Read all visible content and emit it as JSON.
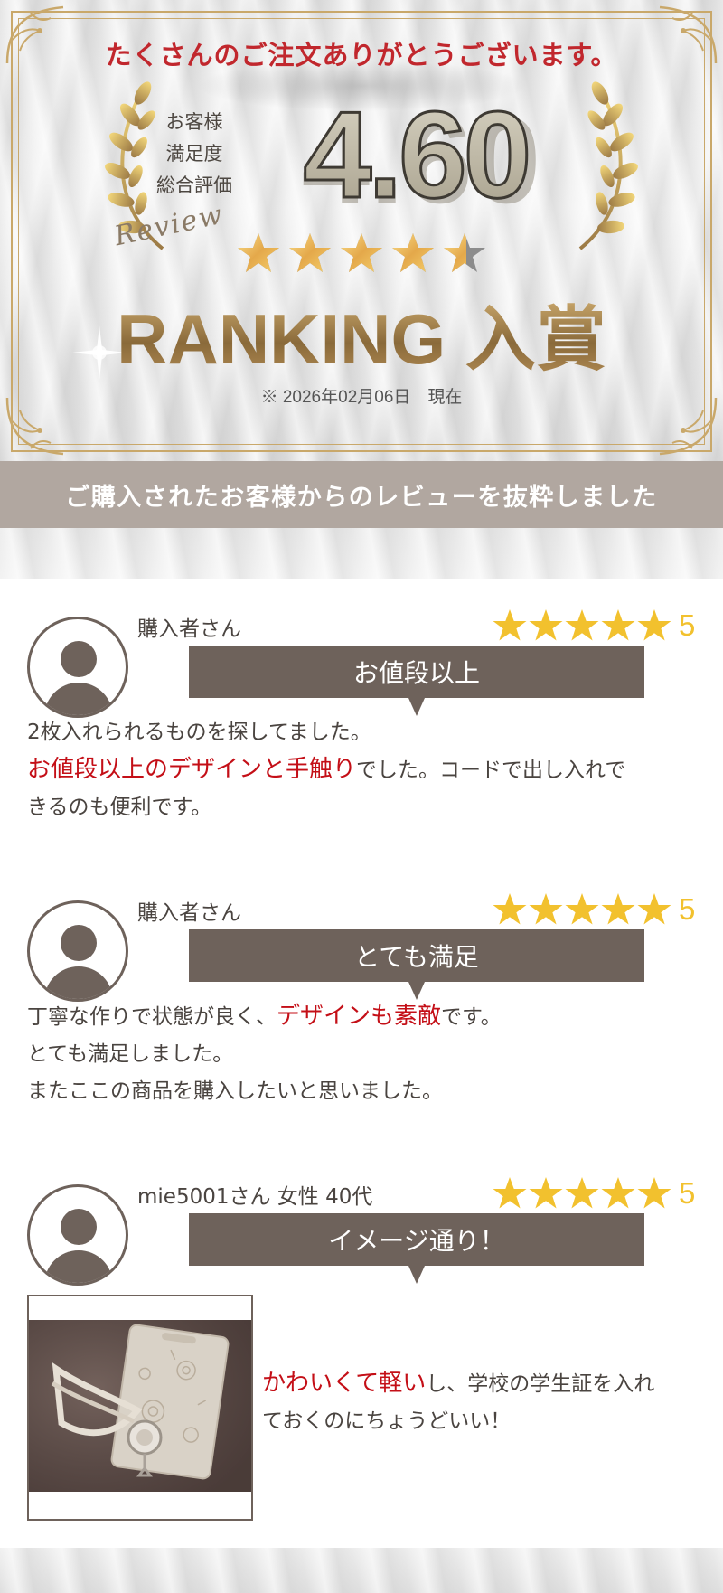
{
  "hero": {
    "thanks": "たくさんのご注文ありがとうございます。",
    "satisfaction_lines": [
      "お客様",
      "満足度",
      "総合評価"
    ],
    "review_script": "Review",
    "score": "4.60",
    "ranking": "RANKING 入賞",
    "date": "※ 2026年02月06日　現在",
    "rating_fraction": 0.92
  },
  "banner": {
    "text": "ご購入されたお客様からのレビューを抜粋しました"
  },
  "reviews": [
    {
      "reviewer": "購入者さん",
      "rating": "5",
      "headline": "お値段以上",
      "lines": [
        {
          "plain": "2枚入れられるものを探してました。"
        },
        {
          "highlight": "お値段以上のデザインと手触り",
          "after": "でした。コードで出し入れで"
        },
        {
          "plain": "きるのも便利です。"
        }
      ]
    },
    {
      "reviewer": "購入者さん",
      "rating": "5",
      "headline": "とても満足",
      "lines": [
        {
          "before": "丁寧な作りで状態が良く、",
          "highlight": "デザインも素敵",
          "after": "です。"
        },
        {
          "plain": "とても満足しました。"
        },
        {
          "plain": "またここの商品を購入したいと思いました。"
        }
      ]
    },
    {
      "reviewer": "mie5001さん  女性  40代",
      "rating": "5",
      "headline": "イメージ通り！",
      "photo_icon": "product-photo-card-holder",
      "lines": [
        {
          "highlight": "かわいくて軽い",
          "after": "し、学校の学生証を入れ"
        },
        {
          "plain": "ておくのにちょうどいい！"
        }
      ]
    }
  ],
  "colors": {
    "accent_red": "#c1272d",
    "highlight_red": "#c40f17",
    "brown": "#6e625b",
    "banner": "#b1a7a0",
    "star_yellow": "#f2c12e",
    "gold": "#c9a86a"
  }
}
